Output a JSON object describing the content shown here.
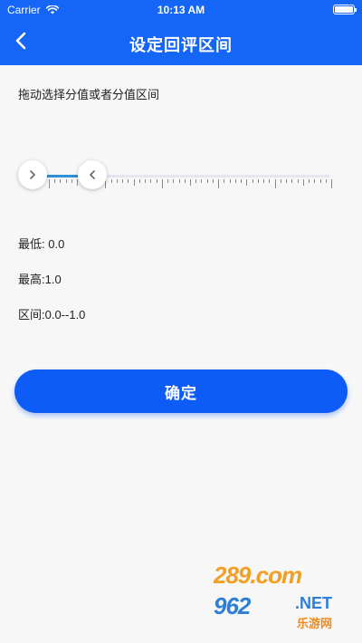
{
  "status_bar": {
    "carrier": "Carrier",
    "time": "10:13 AM"
  },
  "nav": {
    "title": "设定回评区间",
    "back_icon": "chevron-left-icon"
  },
  "instruction": "拖动选择分值或者分值区间",
  "slider": {
    "min_value": 0.0,
    "max_value": 1.0,
    "range_min": 0,
    "range_max": 5,
    "track_color": "#e6e3f2",
    "fill_color": "#2f8fd8",
    "left_handle_icon": "chevron-right-icon",
    "right_handle_icon": "chevron-left-icon"
  },
  "info": {
    "min_label": "最低: 0.0",
    "max_label": "最高:1.0",
    "range_label": "区间:0.0--1.0"
  },
  "confirm_button": "确定",
  "watermark": {
    "top": "289.com",
    "bottom": "962",
    "net": ".NET",
    "cn": "乐游网"
  },
  "colors": {
    "primary": "#1565f6",
    "button": "#0d5cf6"
  }
}
